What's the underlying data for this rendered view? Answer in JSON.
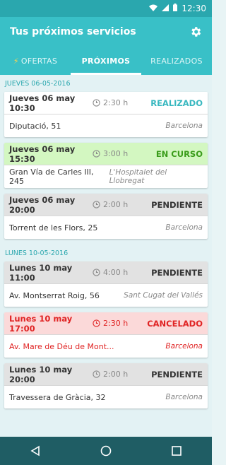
{
  "status_bar": {
    "time": "12:30"
  },
  "appbar": {
    "title": "Tus próximos servicios"
  },
  "tabs": [
    {
      "label": "OFERTAS",
      "active": false
    },
    {
      "label": "PRÓXIMOS",
      "active": true
    },
    {
      "label": "REALIZADOS",
      "active": false
    }
  ],
  "groups": [
    {
      "date": "JUEVES 06-05-2016",
      "services": [
        {
          "datetime": "Jueves 06 may  10:30",
          "duration": "2:30 h",
          "status": "REALIZADO",
          "street": "Diputació, 51",
          "city": "Barcelona"
        },
        {
          "datetime": "Jueves 06 may  15:30",
          "duration": "3:00 h",
          "status": "EN CURSO",
          "street": "Gran Vía de Carles III, 245",
          "city": "L'Hospitalet del Llobregat"
        },
        {
          "datetime": "Jueves 06 may  20:00",
          "duration": "2:00 h",
          "status": "PENDIENTE",
          "street": "Torrent de les Flors, 25",
          "city": "Barcelona"
        }
      ]
    },
    {
      "date": "LUNES 10-05-2016",
      "services": [
        {
          "datetime": "Lunes 10 may  11:00",
          "duration": "4:00 h",
          "status": "PENDIENTE",
          "street": "Av. Montserrat Roig, 56",
          "city": "Sant Cugat del Vallés"
        },
        {
          "datetime": "Lunes 10 may  17:00",
          "duration": "2:30 h",
          "status": "CANCELADO",
          "street": "Av. Mare de Déu de Mont...",
          "city": "Barcelona"
        },
        {
          "datetime": "Lunes 10 may  20:00",
          "duration": "2:00 h",
          "status": "PENDIENTE",
          "street": "Travessera de Gràcia, 32",
          "city": "Barcelona"
        }
      ]
    }
  ],
  "colors": {
    "primary": "#39c0c7",
    "status_bar": "#2aa7ae",
    "realizado": "#39b8c0",
    "en_curso_bg": "#d3f7c1",
    "pendiente_bg": "#e2e2e2",
    "cancelado": "#e02424"
  }
}
